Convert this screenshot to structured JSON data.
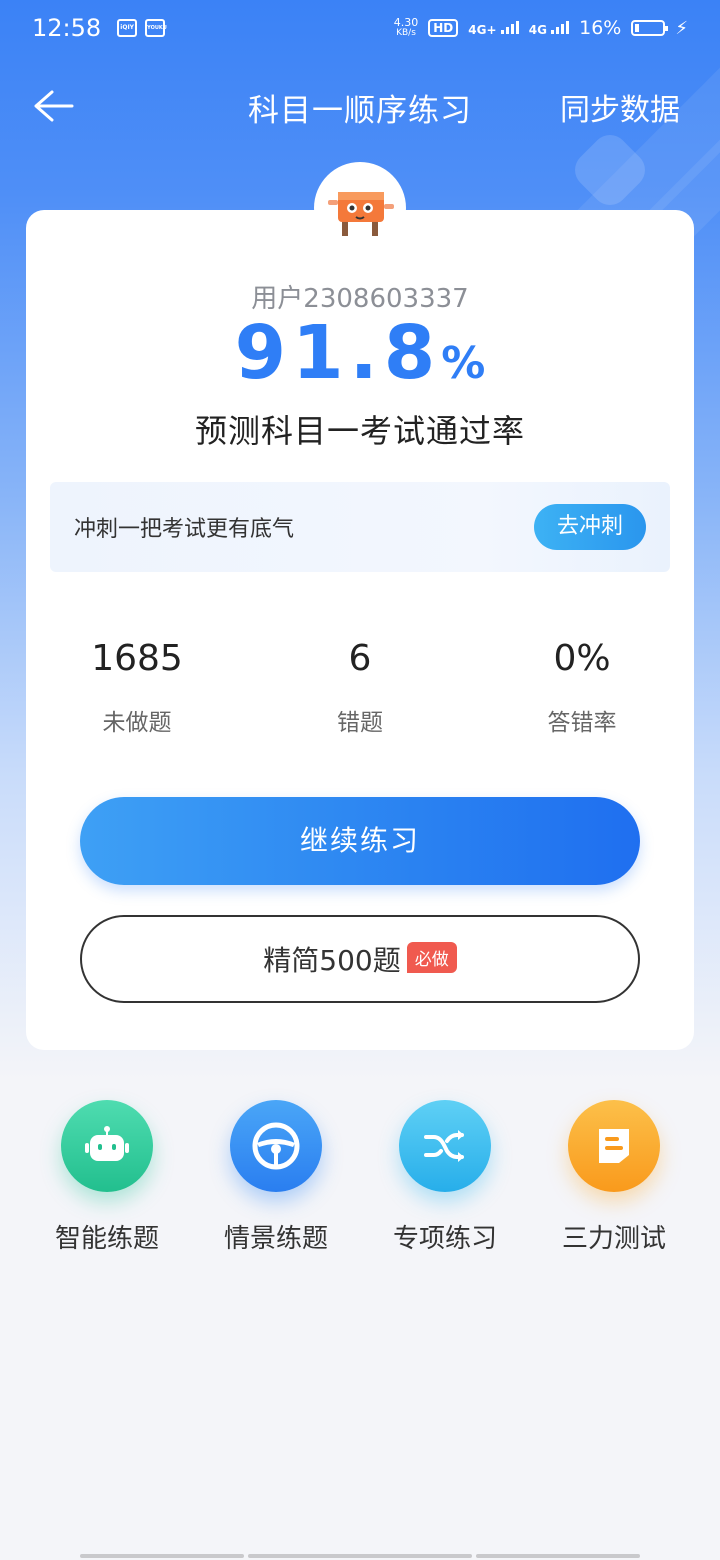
{
  "status_bar": {
    "time": "12:58",
    "apps": [
      "iQIY",
      "YOUKU"
    ],
    "speed_value": "4.30",
    "speed_unit": "KB/s",
    "hd": "HD",
    "net1": "4G+",
    "net2": "4G",
    "battery": "16%"
  },
  "header": {
    "title": "科目一顺序练习",
    "sync": "同步数据"
  },
  "card": {
    "username": "用户2308603337",
    "rate_value": "91.8",
    "rate_unit": "%",
    "rate_label": "预测科目一考试通过率",
    "banner_text": "冲刺一把考试更有底气",
    "banner_button": "去冲刺",
    "stats": [
      {
        "value": "1685",
        "label": "未做题"
      },
      {
        "value": "6",
        "label": "错题"
      },
      {
        "value": "0%",
        "label": "答错率"
      }
    ],
    "primary_button": "继续练习",
    "secondary_button": "精简500题",
    "secondary_badge": "必做"
  },
  "features": [
    {
      "label": "智能练题",
      "icon": "robot-icon",
      "color": "#2ec79b"
    },
    {
      "label": "情景练题",
      "icon": "steering-wheel-icon",
      "color": "#2f86f3"
    },
    {
      "label": "专项练习",
      "icon": "shuffle-icon",
      "color": "#34b8ef"
    },
    {
      "label": "三力测试",
      "icon": "document-icon",
      "color": "#fbaa2a"
    }
  ]
}
